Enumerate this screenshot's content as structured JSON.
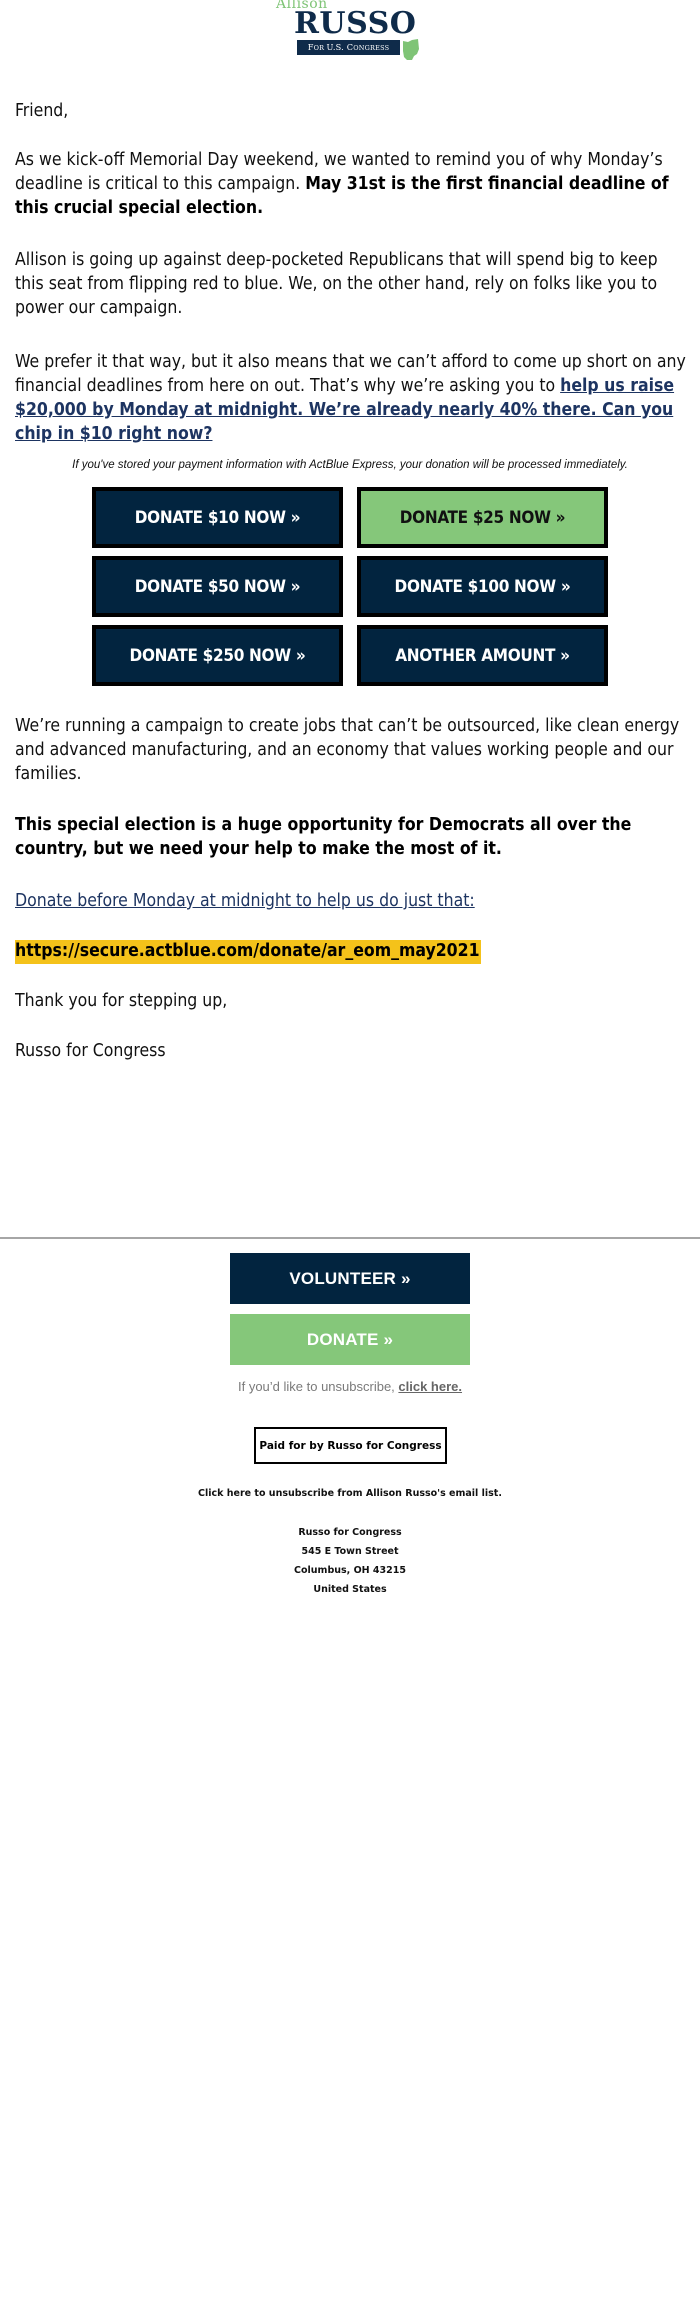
{
  "logo": {
    "first_name": "Allison",
    "last_name": "RUSSO",
    "tagline_prefix": "F",
    "tagline_prefix_sc": "OR ",
    "tagline_mid": "U.S. C",
    "tagline_sc": "ONGRESS",
    "state_icon": "ohio-state-icon",
    "colors": {
      "navy": "#0f2b4a",
      "green": "#7fc476"
    }
  },
  "body": {
    "greeting": "Friend,",
    "p1_text": "As we kick-off Memorial Day weekend, we wanted to remind you of why Monday’s deadline is critical to this campaign. ",
    "p1_bold": "May 31st is the first financial deadline of this crucial special election.",
    "p2": "Allison is going up against deep-pocketed Republicans that will spend big to keep this seat from flipping red to blue. We, on the other hand, rely on folks like you to power our campaign.",
    "p3_text": "We prefer it that way, but it also means that we can’t afford to come up short on any financial deadlines from here on out. That’s why we’re asking you to ",
    "p3_link": "help us raise $20,000 by Monday at midnight. We’re already nearly 40% there. Can you chip in $10 right now?",
    "express_note": "If you've stored your payment information with ActBlue Express, your donation will be processed immediately.",
    "donate_buttons": [
      {
        "label": "DONATE $10 NOW »",
        "style": "navy"
      },
      {
        "label": "DONATE $25 NOW »",
        "style": "green"
      },
      {
        "label": "DONATE $50 NOW »",
        "style": "navy"
      },
      {
        "label": "DONATE $100 NOW »",
        "style": "navy"
      },
      {
        "label": "DONATE $250 NOW »",
        "style": "navy"
      },
      {
        "label": "ANOTHER AMOUNT »",
        "style": "navy"
      }
    ],
    "p4": "We’re running a campaign to create jobs that can’t be outsourced, like clean energy and advanced manufacturing, and an economy that values working people and our families.",
    "p5_bold": "This special election is a huge opportunity for Democrats all over the country, but we need your help to make the most of it.",
    "p6_link": "Donate before Monday at midnight to help us do just that:",
    "donate_url": "https://secure.actblue.com/donate/ar_eom_may2021",
    "signoff": "Thank you for stepping up,",
    "signature": "Russo for Congress"
  },
  "footer": {
    "volunteer_label": "VOLUNTEER »",
    "donate_label": "DONATE »",
    "unsubscribe_text": "If you’d like to unsubscribe, ",
    "unsubscribe_link": "click here.",
    "paid_for": "Paid for by Russo for Congress",
    "unsubscribe_list": "Click here to unsubscribe from Allison Russo's email list.",
    "address": [
      "Russo for Congress",
      "545 E Town Street",
      "Columbus, OH 43215",
      "United States"
    ]
  },
  "colors": {
    "navy": "#02243f",
    "green": "#85c77a",
    "link": "#1d3461",
    "highlight": "#f4c21a"
  }
}
